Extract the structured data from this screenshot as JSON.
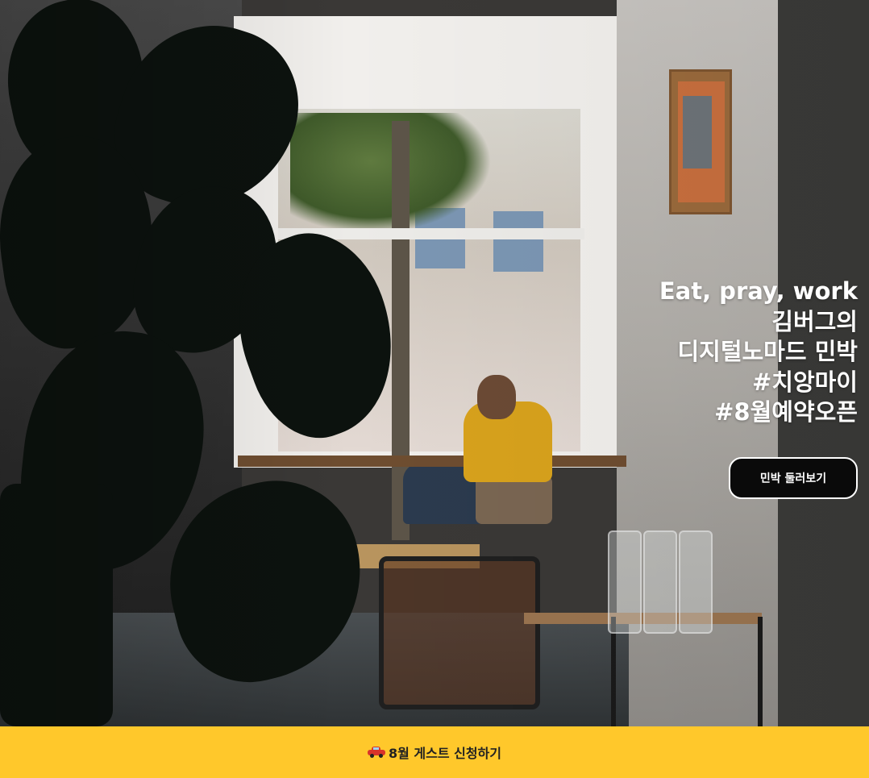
{
  "hero": {
    "lines": [
      "Eat, pray, work",
      "김버그의",
      "디지털노마드 민박",
      "#치앙마이",
      "#8월예약오픈"
    ],
    "cta_label": "민박 둘러보기"
  },
  "banner": {
    "icon": "car-icon",
    "label": "8월 게스트 신청하기"
  },
  "colors": {
    "banner_bg": "#ffc82b",
    "cta_bg": "#0a0a0a",
    "cta_border": "#ffffff",
    "hero_text": "#ffffff"
  }
}
